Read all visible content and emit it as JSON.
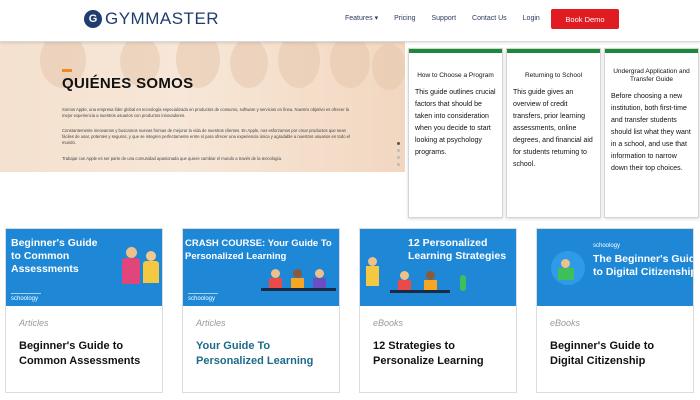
{
  "nav": {
    "logo_g": "G",
    "logo_text": "GYMMASTER",
    "links": {
      "features": "Features ▾",
      "pricing": "Pricing",
      "support": "Support",
      "contact": "Contact Us",
      "login": "Login"
    },
    "cta": "Book Demo",
    "colors": {
      "brand": "#1f3d6e",
      "cta": "#e11b22"
    }
  },
  "hero": {
    "title": "QUIÉNES SOMOS",
    "para1": "Somos Apple, una empresa líder global en tecnología especializada en productos de consumo, software y servicios en línea. Nuestro objetivo es ofrecer la mejor experiencia a nuestros usuarios con productos innovadores.",
    "para2": "Constantemente innovamos y buscamos nuevas formas de mejorar la vida de nuestros clientes. En Apple, nos esforzamos por crear productos que sean fáciles de usar, potentes y seguros, y que se integren perfectamente entre sí para ofrecer una experiencia única y agradable a nuestros usuarios en todo el mundo.",
    "para3": "Trabajar con Apple es ser parte de una comunidad apasionada que quiere cambiar el mundo a través de la tecnología."
  },
  "panels": [
    {
      "title": "How to Choose a Program",
      "body": "This guide outlines crucial factors that should be taken into consideration when you decide to start looking at psychology programs."
    },
    {
      "title": "Returning to School",
      "body": "This guide gives an overview of credit transfers, prior learning assessments, online degrees, and financial aid for students returning to school."
    },
    {
      "title": "Undergrad Application and Transfer Guide",
      "body": "Before choosing a new institution, both first-time and transfer students should list what they want in a school, and use that information to narrow down their top choices."
    }
  ],
  "panel_accent": "#1a8a3a",
  "cards": [
    {
      "image_title": "Beginner's Guide to Common Assessments",
      "brand": "schoology",
      "category": "Articles",
      "title": "Beginner's Guide to Common Assessments"
    },
    {
      "image_title": "CRASH COURSE: Your Guide To Personalized Learning",
      "brand": "schoology",
      "category": "Articles",
      "title": "Your Guide To Personalized Learning"
    },
    {
      "image_title": "12 Personalized Learning Strategies",
      "brand": "",
      "category": "eBooks",
      "title": "12 Strategies to Personalize Learning"
    },
    {
      "image_title": "The Beginner's Guide to Digital Citizenship",
      "brand": "schoology",
      "category": "eBooks",
      "title": "Beginner's Guide to Digital Citizenship"
    }
  ],
  "card_colors": {
    "image_bg": "#1e88d6",
    "title_teal": "#1c6b8a",
    "category": "#999999"
  }
}
